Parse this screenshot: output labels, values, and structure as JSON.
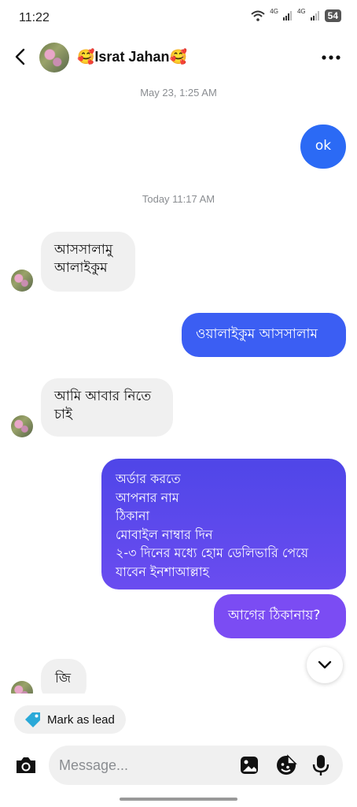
{
  "status_bar": {
    "time": "11:22",
    "signal1": "4G",
    "signal2": "4G",
    "battery": "54"
  },
  "header": {
    "contact_name": "🥰Israt Jahan🥰"
  },
  "timestamps": {
    "first": "May 23, 1:25 AM",
    "second": "Today 11:17 AM"
  },
  "messages": {
    "m1": "ok",
    "m2_line1": "আসসালামু",
    "m2_line2": "আলাইকুম",
    "m3": "ওয়ালাইকুম আসসালাম",
    "m4_line1": "আমি আবার নিতে",
    "m4_line2": "চাই",
    "m5_lines": [
      "অর্ডার করতে",
      "আপনার নাম",
      "ঠিকানা",
      "মোবাইল নাম্বার দিন",
      "২-৩ দিনের মধ্যে হোম ডেলিভারি পেয়ে",
      "যাবেন ইনশাআল্লাহ"
    ],
    "m6": "আগের ঠিকানায়?",
    "m7": "জি"
  },
  "lead_chip": {
    "label": "Mark as lead"
  },
  "composer": {
    "placeholder": "Message..."
  },
  "colors": {
    "blue": "#2b6af5",
    "indigo": "#4f46e8",
    "purple": "#7b4cf3"
  },
  "icons": [
    "back-arrow-icon",
    "more-icon",
    "tag-icon",
    "camera-icon",
    "gallery-icon",
    "sticker-icon",
    "mic-icon",
    "chevron-down-icon",
    "wifi-icon"
  ]
}
